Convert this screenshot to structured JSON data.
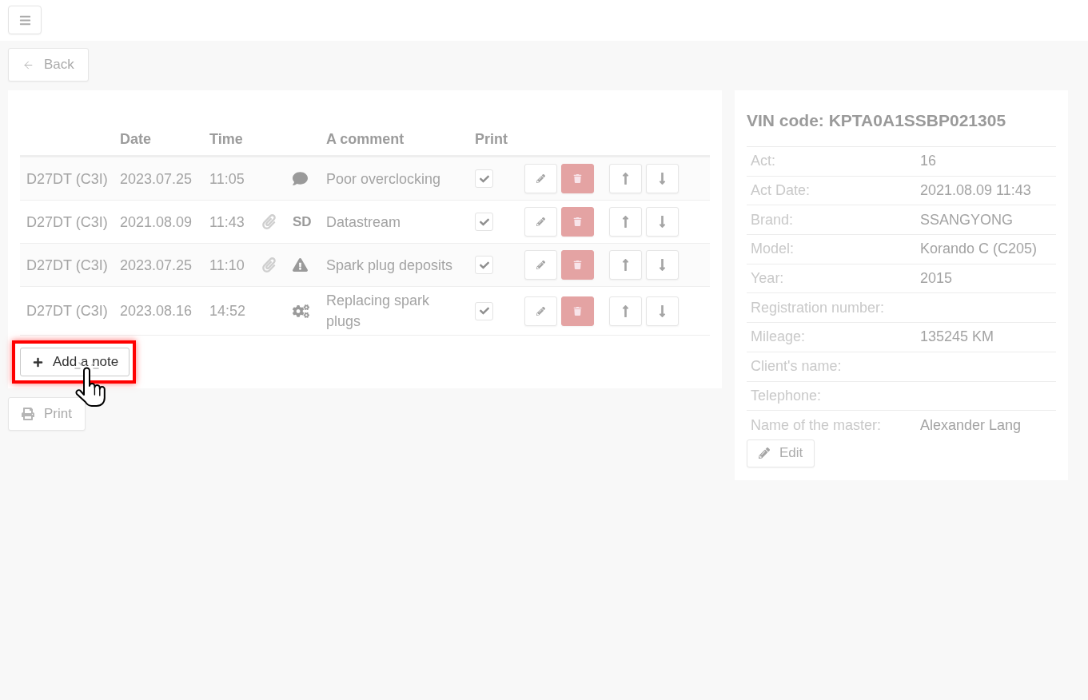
{
  "back_button": {
    "label": "Back"
  },
  "notes_table": {
    "columns": {
      "date": "Date",
      "time": "Time",
      "comment": "A comment",
      "print": "Print"
    },
    "rows": [
      {
        "model": "D27DT (C3I)",
        "date": "2023.07.25",
        "time": "11:05",
        "attachment": false,
        "marker": {
          "kind": "comment"
        },
        "comment": "Poor overclocking",
        "print": true
      },
      {
        "model": "D27DT (C3I)",
        "date": "2021.08.09",
        "time": "11:43",
        "attachment": true,
        "marker": {
          "kind": "label",
          "text": "SD"
        },
        "comment": "Datastream",
        "print": true
      },
      {
        "model": "D27DT (C3I)",
        "date": "2023.07.25",
        "time": "11:10",
        "attachment": true,
        "marker": {
          "kind": "warning"
        },
        "comment": "Spark plug deposits",
        "print": true
      },
      {
        "model": "D27DT (C3I)",
        "date": "2023.08.16",
        "time": "14:52",
        "attachment": false,
        "marker": {
          "kind": "gears"
        },
        "comment": "Replacing spark plugs",
        "print": true
      }
    ]
  },
  "add_note_button": {
    "label": "Add a note",
    "highlighted": true
  },
  "print_button": {
    "label": "Print"
  },
  "vehicle_panel": {
    "title": "VIN code: KPTA0A1SSBP021305",
    "fields": [
      {
        "label": "Act:",
        "value": "16"
      },
      {
        "label": "Act Date:",
        "value": "2021.08.09 11:43"
      },
      {
        "label": "Brand:",
        "value": "SSANGYONG"
      },
      {
        "label": "Model:",
        "value": "Korando C (C205)"
      },
      {
        "label": "Year:",
        "value": "2015"
      },
      {
        "label": "Registration number:"
      },
      {
        "label": "Mileage:",
        "value": "135245 KM"
      },
      {
        "label": "Client's name:"
      },
      {
        "label": "Telephone:"
      },
      {
        "label": "Name of the master:",
        "value": "Alexander Lang"
      }
    ],
    "edit_button": {
      "label": "Edit"
    }
  }
}
